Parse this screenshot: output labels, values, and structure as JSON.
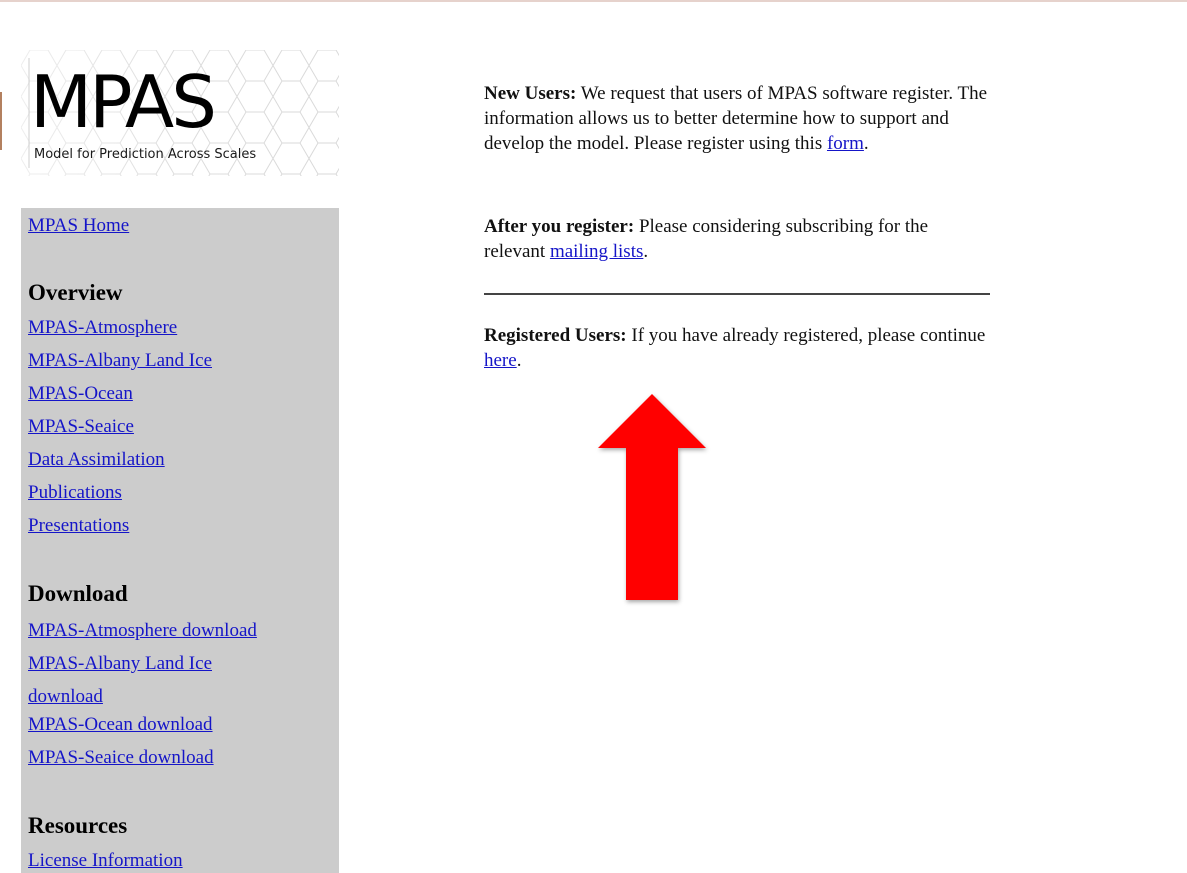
{
  "logo": {
    "word": "MPAS",
    "tagline": "Model for Prediction Across Scales"
  },
  "sidebar": {
    "home_link": "MPAS Home",
    "sections": [
      {
        "heading": "Overview",
        "links": [
          "MPAS-Atmosphere",
          "MPAS-Albany Land Ice",
          "MPAS-Ocean",
          "MPAS-Seaice",
          "Data Assimilation",
          "Publications",
          "Presentations"
        ]
      },
      {
        "heading": "Download",
        "links": [
          "MPAS-Atmosphere download",
          "MPAS-Albany Land Ice download",
          "MPAS-Ocean download",
          "MPAS-Seaice download"
        ]
      },
      {
        "heading": "Resources",
        "links": [
          "License Information"
        ]
      }
    ]
  },
  "main": {
    "new_users": {
      "label": "New Users:",
      "text_before": " We request that users of MPAS software register. The information allows us to better determine how to support and develop the model. Please register using this ",
      "link": "form",
      "text_after": "."
    },
    "after_register": {
      "label": "After you register:",
      "text_before": " Please considering subscribing for the relevant ",
      "link": "mailing lists",
      "text_after": "."
    },
    "registered_users": {
      "label": "Registered Users:",
      "text_before": " If you have already registered, please continue ",
      "link": "here",
      "text_after": "."
    }
  },
  "annotation": {
    "arrow_color": "#ff0000",
    "arrow_icon": "up-arrow"
  },
  "colors": {
    "sidebar_bg": "#cccccc",
    "link": "#1515c8"
  }
}
